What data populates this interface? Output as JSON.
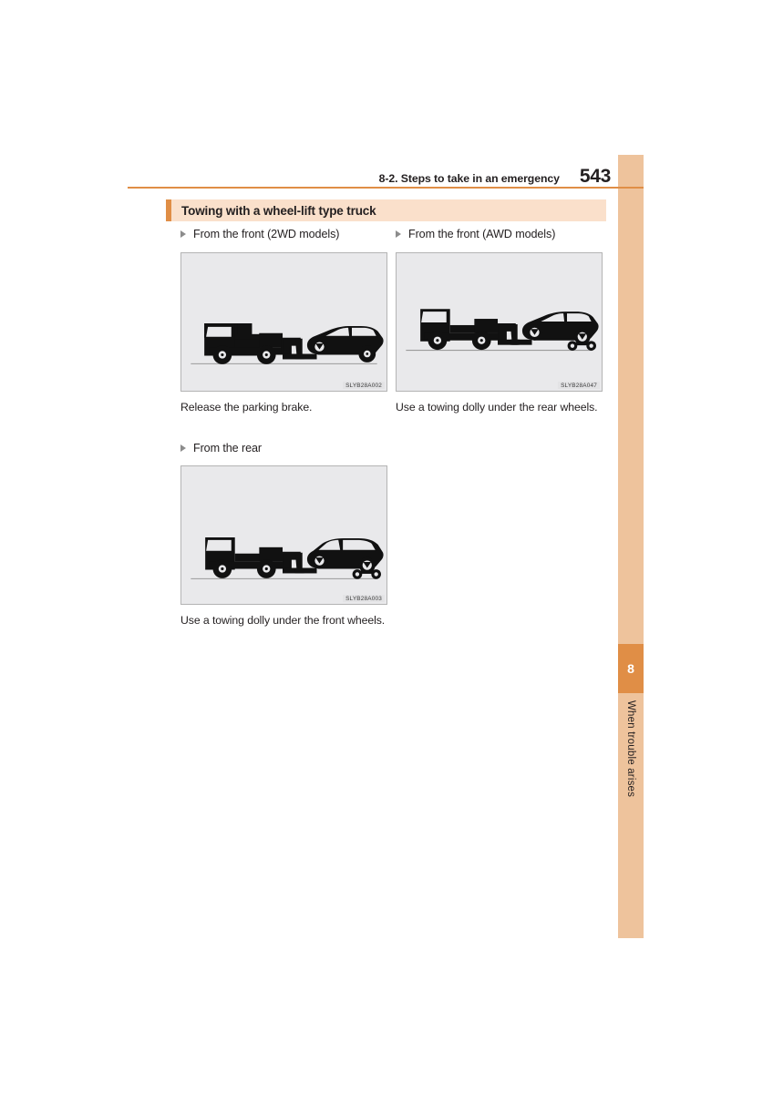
{
  "header": {
    "section_label": "8-2. Steps to take in an emergency",
    "page_number": "543"
  },
  "section": {
    "title": "Towing with a wheel-lift type truck"
  },
  "side_tab": {
    "chapter_number": "8",
    "chapter_label": "When trouble arises"
  },
  "blocks": [
    {
      "heading": "From the front (2WD models)",
      "figure_code": "SLYB28A002",
      "caption": "Release the parking brake."
    },
    {
      "heading": "From the front (AWD models)",
      "figure_code": "SLYB28A047",
      "caption": "Use a towing dolly under the rear wheels."
    },
    {
      "heading": "From the rear",
      "figure_code": "SLYB28A003",
      "caption": "Use a towing dolly under the front wheels."
    }
  ],
  "colors": {
    "accent_orange": "#e08e46",
    "band_peach": "#fae0cb",
    "tab_peach": "#eec39c",
    "figure_bg": "#e9e9eb",
    "text": "#231f20"
  }
}
